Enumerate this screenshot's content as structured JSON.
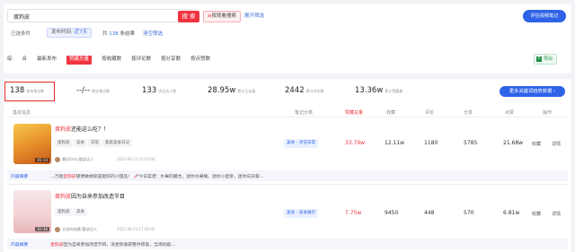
{
  "search": {
    "value": "蛋狗皮",
    "button": "搜 索",
    "tag_search": "按观看搜索",
    "tag_prefix": "≥",
    "expand": "展开筛选",
    "eval_button": "评估视频笔记"
  },
  "filter": {
    "label": "已选条件",
    "chip_label": "发布时间:",
    "chip_value": "近7天",
    "found_prefix": "共",
    "found_count": "138",
    "found_suffix": "条结果",
    "clear": "清空筛选"
  },
  "sort": {
    "items": [
      "综",
      "合",
      "最新发布",
      "赞藏总量",
      "按收藏数",
      "按评论数",
      "按分享数",
      "按点赞数"
    ],
    "active_index": 3,
    "export": "导出"
  },
  "stats": [
    {
      "value": "138",
      "label": "发布笔记数"
    },
    {
      "value": "--/--",
      "label": "商业笔记数"
    },
    {
      "value": "133",
      "label": "涉及达人数"
    },
    {
      "value": "28.95w",
      "label": "累计互动量"
    },
    {
      "value": "2442",
      "label": "累计评论数"
    },
    {
      "value": "13.36w",
      "label": "累计赞藏量"
    }
  ],
  "stats_button": "更多关键词趋势数据 ›",
  "table": {
    "headers": [
      "基本信息",
      "笔记分类",
      "赞藏总量",
      "收藏",
      "评论",
      "分享",
      "点赞",
      "操作"
    ]
  },
  "rows": [
    {
      "title_hl": "蛋狗皮",
      "title_rest": "还能这么吃？！",
      "tags": [
        "蛋狗皮",
        "美食",
        "日常",
        "家庭美食日记"
      ],
      "author": "寡妇Orla",
      "author_tag": "腰部达人",
      "date": "2022-06-23 15:03:08",
      "duration": "01:14",
      "category": "美食 - 烹饪日常",
      "total": "33.79w",
      "collect": "12.11w",
      "comment": "1180",
      "share": "5785",
      "like": "21.68w",
      "op1": "收藏",
      "op2": "详情",
      "strip_label": "内容摘要",
      "strip_text_pre": "...万能",
      "strip_hl": "蛋狗皮",
      "strip_text_post": "随便做做就是挺好的小甜品！ 🥢今日菜谱：水果的撮合，迷你水果摊，迷你小蛋饼，迷你向日葵..."
    },
    {
      "title_hl": "蛋狗皮",
      "title_rest": "因为自来参加改造节目",
      "tags": [
        "蛋狗皮",
        "美食"
      ],
      "author": "太阳的喵酱",
      "author_tag": "腰部达人",
      "date": "2022-06-23 17:06:00",
      "duration": "01:36",
      "category": "美食 - 美食展示",
      "total": "7.75w",
      "collect": "9450",
      "comment": "448",
      "share": "570",
      "like": "6.81w",
      "op1": "收藏",
      "op2": "详情",
      "strip_label": "内容摘要",
      "strip_text_pre": "",
      "strip_hl": "蛋狗皮",
      "strip_text_post": "因为自来参加改造节目，没想到收获整件惨案，当场动画..."
    }
  ],
  "icons": {
    "export": "excel-icon",
    "search_tag": "flame-icon"
  },
  "colors": {
    "accent": "#f0343f",
    "brand": "#2e63e8"
  }
}
